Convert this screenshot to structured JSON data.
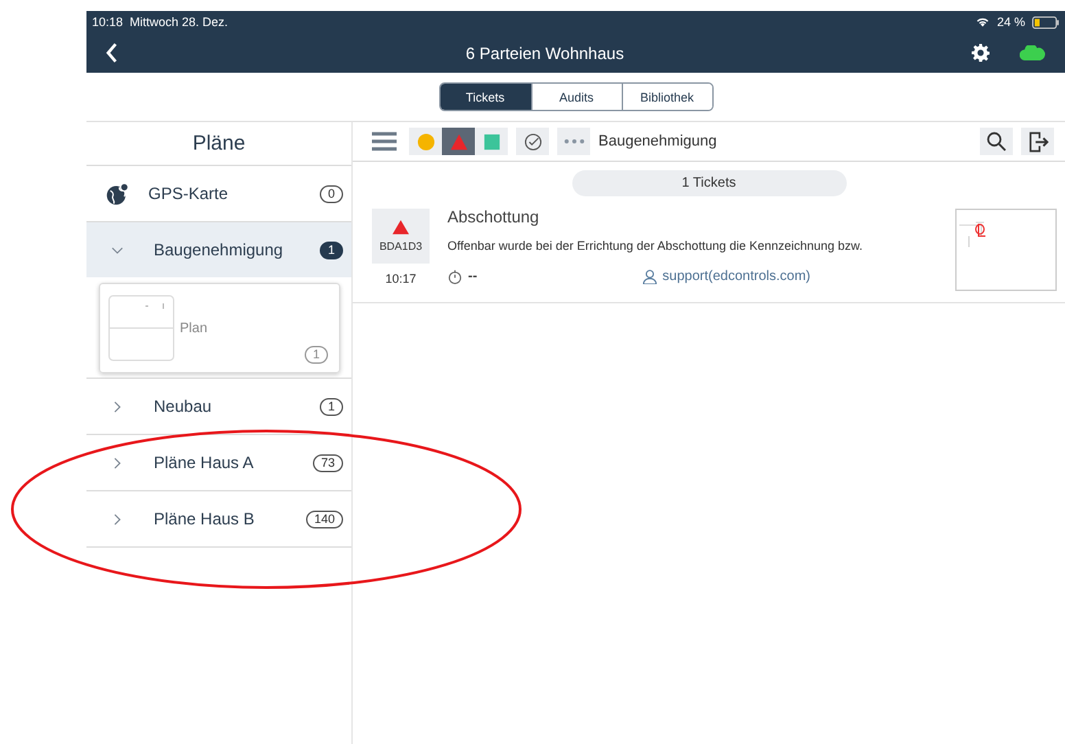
{
  "status_bar": {
    "time": "10:18",
    "date": "Mittwoch 28. Dez.",
    "battery": "24 %"
  },
  "header": {
    "title": "6 Parteien Wohnhaus"
  },
  "tabs": [
    {
      "label": "Tickets",
      "selected": true
    },
    {
      "label": "Audits",
      "selected": false
    },
    {
      "label": "Bibliothek",
      "selected": false
    }
  ],
  "sidebar": {
    "title": "Pläne",
    "items": [
      {
        "kind": "map",
        "label": "GPS-Karte",
        "count": "0",
        "selected": false
      },
      {
        "kind": "folder",
        "label": "Baugenehmigung",
        "count": "1",
        "selected": true,
        "expanded": true,
        "children": [
          {
            "label": "Plan",
            "count": "1"
          }
        ]
      },
      {
        "kind": "folder",
        "label": "Neubau",
        "count": "1",
        "selected": false,
        "expanded": false
      },
      {
        "kind": "folder",
        "label": "Pläne Haus A",
        "count": "73",
        "selected": false,
        "expanded": false
      },
      {
        "kind": "folder",
        "label": "Pläne Haus B",
        "count": "140",
        "selected": false,
        "expanded": false
      }
    ]
  },
  "toolbar": {
    "filters": [
      {
        "kind": "circle",
        "color": "#f5b400",
        "selected": false
      },
      {
        "kind": "triangle",
        "color": "#e8262b",
        "selected": true
      },
      {
        "kind": "square",
        "color": "#3cc49a",
        "selected": false
      }
    ],
    "breadcrumb": "Baugenehmigung"
  },
  "ticket_count": "1 Tickets",
  "tickets": [
    {
      "title": "Abschottung",
      "code": "BDA1D3",
      "time": "10:17",
      "description": "Offenbar wurde bei der Errichtung der Abschottung die Kennzeichnung bzw.",
      "due": "--",
      "assignee": "support(edcontrols.com)",
      "color": "#e8262b"
    }
  ]
}
